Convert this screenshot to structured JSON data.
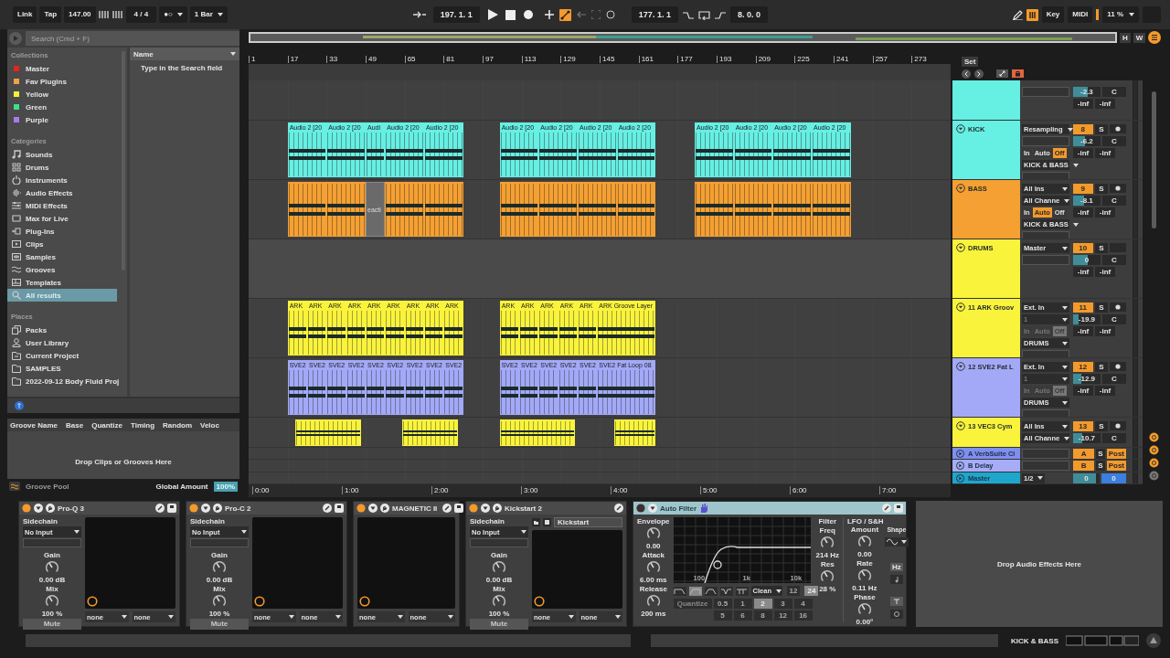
{
  "transport": {
    "link": "Link",
    "tap": "Tap",
    "tempo": "147.00",
    "signature": "4 / 4",
    "metronome": "●○",
    "quantize": "1 Bar",
    "position": "197. 1. 1",
    "automation_arm": true,
    "loop_start": "177. 1. 1",
    "loop_length": "8. 0. 0",
    "computer_keyboard": true,
    "key": "Key",
    "midi": "MIDI",
    "cpu": "11 %"
  },
  "browser": {
    "search": {
      "placeholder": "Search (Cmd + F)"
    },
    "collections_title": "Collections",
    "collections": [
      {
        "label": "Master",
        "color": "#e8221c"
      },
      {
        "label": "Fav Plugins",
        "color": "#f0a048"
      },
      {
        "label": "Yellow",
        "color": "#f4f03a"
      },
      {
        "label": "Green",
        "color": "#3ee08a"
      },
      {
        "label": "Purple",
        "color": "#a57cf0"
      }
    ],
    "categories_title": "Categories",
    "categories": [
      {
        "label": "Sounds",
        "selected": false
      },
      {
        "label": "Drums",
        "selected": false
      },
      {
        "label": "Instruments",
        "selected": false
      },
      {
        "label": "Audio Effects",
        "selected": false
      },
      {
        "label": "MIDI Effects",
        "selected": false
      },
      {
        "label": "Max for Live",
        "selected": false
      },
      {
        "label": "Plug-Ins",
        "selected": false
      },
      {
        "label": "Clips",
        "selected": false
      },
      {
        "label": "Samples",
        "selected": false
      },
      {
        "label": "Grooves",
        "selected": false
      },
      {
        "label": "Templates",
        "selected": false
      },
      {
        "label": "All results",
        "selected": true
      }
    ],
    "places_title": "Places",
    "places": [
      {
        "label": "Packs"
      },
      {
        "label": "User Library"
      },
      {
        "label": "Current Project"
      },
      {
        "label": "SAMPLES"
      },
      {
        "label": "2022-09-12 Body Fluid Proj"
      }
    ],
    "name_column": "Name",
    "hint": "Type in the Search field"
  },
  "groove_pool": {
    "columns": [
      "Groove Name",
      "Base",
      "Quantize",
      "Timing",
      "Random",
      "Veloc"
    ],
    "empty_hint": "Drop Clips or Grooves Here",
    "title": "Groove Pool",
    "global_amount_label": "Global Amount",
    "global_amount": "100%"
  },
  "arrangement": {
    "bar_ticks": [
      "1",
      "17",
      "33",
      "49",
      "65",
      "81",
      "97",
      "113",
      "129",
      "145",
      "161",
      "177",
      "193",
      "209",
      "225",
      "241",
      "257",
      "273"
    ],
    "time_ticks": [
      "0:00",
      "1:00",
      "2:00",
      "3:00",
      "4:00",
      "5:00",
      "6:00",
      "7:00"
    ],
    "zoom_h": "H",
    "zoom_w": "W",
    "set": "Set"
  },
  "tracks": [
    {
      "kind": "partial",
      "color": "#66efe3",
      "volume": {
        "value": "-2.3",
        "level": 0.55
      },
      "pan": "C",
      "peaks": [
        "-inf",
        "-inf"
      ]
    },
    {
      "kind": "audio",
      "name": "KICK",
      "color": "#66efe3",
      "input": "Resampling",
      "monitor": [
        {
          "label": "In",
          "selected": false
        },
        {
          "label": "Auto",
          "selected": false
        },
        {
          "label": "Off",
          "selected": true
        }
      ],
      "monitor_disabled": false,
      "output": "KICK & BASS",
      "number": "8",
      "solo": "S",
      "volume": {
        "value": "-6.2",
        "level": 0.45
      },
      "pan": "C",
      "peaks": [
        "-inf",
        "-inf"
      ],
      "clips": [
        {
          "label": "Audio 2 [20",
          "active": true
        },
        {
          "label": "Audio 2 [20",
          "active": true
        },
        {
          "label": "Audi",
          "active": true
        },
        {
          "label": "Audio 2 [20",
          "active": true
        },
        {
          "label": "Audio 2 [20",
          "active": true
        },
        {
          "label": "Audio 2 [20",
          "active": true
        },
        {
          "label": "Audio 2 [20",
          "active": true
        },
        {
          "label": "Audio 2 [20",
          "active": true
        },
        {
          "label": "Audio 2 [20",
          "active": true
        },
        {
          "label": "Audio 2 [20",
          "active": true
        },
        {
          "label": "Audio 2 [20",
          "active": true
        },
        {
          "label": "Audio 2 [20",
          "active": true
        },
        {
          "label": "Audio 2 [20",
          "active": true
        }
      ]
    },
    {
      "kind": "audio",
      "name": "BASS",
      "color": "#f5a032",
      "input": "All Ins",
      "input_channel": "All Channe",
      "monitor": [
        {
          "label": "In",
          "selected": false
        },
        {
          "label": "Auto",
          "selected": true
        },
        {
          "label": "Off",
          "selected": false
        }
      ],
      "monitor_disabled": false,
      "output": "KICK & BASS",
      "number": "9",
      "solo": "S",
      "volume": {
        "value": "-8.1",
        "level": 0.4
      },
      "pan": "C",
      "peaks": [
        "-inf",
        "-inf"
      ],
      "clips": [
        {
          "active": true
        },
        {
          "active": true
        },
        {
          "label": "eacti",
          "active": false
        },
        {
          "active": true
        },
        {
          "active": true
        },
        {
          "active": true
        },
        {
          "active": true
        },
        {
          "active": true
        },
        {
          "active": true
        },
        {
          "active": true
        },
        {
          "active": true
        },
        {
          "active": true
        },
        {
          "active": true
        }
      ]
    },
    {
      "kind": "group",
      "name": "DRUMS",
      "color": "#f9f33c",
      "output": "Master",
      "number": "10",
      "solo": "S",
      "volume": {
        "value": "0",
        "level": 0.55
      },
      "pan": "C",
      "peaks": [
        "-inf",
        "-inf"
      ]
    },
    {
      "kind": "audio",
      "name": "11 ARK Groov",
      "color": "#f9f33c",
      "input": "Ext. In",
      "input_channel": "1",
      "monitor": [
        {
          "label": "In",
          "selected": false
        },
        {
          "label": "Auto",
          "selected": false
        },
        {
          "label": "Off",
          "selected": true
        }
      ],
      "monitor_disabled": true,
      "output": "DRUMS",
      "number": "11",
      "solo": "S",
      "volume": {
        "value": "-19.9",
        "level": 0.2
      },
      "pan": "C",
      "peaks": [
        "-inf",
        "-inf"
      ],
      "clips": [
        {
          "label": "ARK",
          "active": true
        },
        {
          "label": "ARK",
          "active": true
        },
        {
          "label": "ARK",
          "active": true
        },
        {
          "label": "ARK",
          "active": true
        },
        {
          "label": "ARK",
          "active": true
        },
        {
          "label": "ARK",
          "active": true
        },
        {
          "label": "ARK",
          "active": true
        },
        {
          "label": "ARK",
          "active": true
        },
        {
          "label": "ARK",
          "active": true
        },
        {
          "label": "ARK",
          "active": true
        },
        {
          "label": "ARK",
          "active": true
        },
        {
          "label": "ARK",
          "active": true
        },
        {
          "label": "ARK",
          "active": true
        },
        {
          "label": "ARK",
          "active": true
        },
        {
          "label": "ARK Groove Layer",
          "active": true
        }
      ]
    },
    {
      "kind": "audio",
      "name": "12 SVE2 Fat L",
      "color": "#a3a9f7",
      "input": "Ext. In",
      "input_channel": "1",
      "monitor": [
        {
          "label": "In",
          "selected": false
        },
        {
          "label": "Auto",
          "selected": false
        },
        {
          "label": "Off",
          "selected": true
        }
      ],
      "monitor_disabled": true,
      "output": "DRUMS",
      "number": "12",
      "solo": "S",
      "volume": {
        "value": "-12.9",
        "level": 0.3
      },
      "pan": "C",
      "peaks": [
        "-inf",
        "-inf"
      ],
      "clips": [
        {
          "label": "SVE2",
          "active": true
        },
        {
          "label": "SVE2",
          "active": true
        },
        {
          "label": "SVE2",
          "active": true
        },
        {
          "label": "SVE2",
          "active": true
        },
        {
          "label": "SVE2",
          "active": true
        },
        {
          "label": "SVE2",
          "active": true
        },
        {
          "label": "SVE2",
          "active": true
        },
        {
          "label": "SVE2",
          "active": true
        },
        {
          "label": "SVE2",
          "active": true
        },
        {
          "label": "SVE2",
          "active": true
        },
        {
          "label": "SVE2",
          "active": true
        },
        {
          "label": "SVE2",
          "active": true
        },
        {
          "label": "SVE2",
          "active": true
        },
        {
          "label": "SVE2",
          "active": true
        },
        {
          "label": "SVE2 Fat Loop 08",
          "active": true
        }
      ]
    },
    {
      "kind": "audio",
      "name": "13 VEC3 Cym",
      "color": "#f9f33c",
      "input": "All Ins",
      "input_channel": "All Channe",
      "number": "13",
      "solo": "S",
      "volume": {
        "value": "-10.7",
        "level": 0.35
      },
      "pan": "C",
      "clips": [
        {
          "active": true
        },
        {
          "active": true
        },
        {
          "active": true
        },
        {
          "active": true
        }
      ]
    }
  ],
  "returns": [
    {
      "kind": "return",
      "name": "A VerbSuite Cl",
      "color": "#7f8ff0",
      "number": "A",
      "solo": "S",
      "post": "Post"
    },
    {
      "kind": "return",
      "name": "B Delay",
      "color": "#a6adf6",
      "number": "B",
      "solo": "S",
      "post": "Post"
    },
    {
      "kind": "master",
      "name": "Master",
      "color": "#1ea6cc",
      "output": "1/2",
      "volume": {
        "value": "0",
        "level": 0.85
      },
      "cue": "0"
    }
  ],
  "devices": [
    {
      "kind": "plugin",
      "name": "Pro-Q 3",
      "on": true,
      "sidechain_label": "Sidechain",
      "sidechain": "No Input",
      "gain_label": "Gain",
      "gain": "0.00 dB",
      "mix_label": "Mix",
      "mix": "100 %",
      "mute": "Mute",
      "outputs": [
        "none",
        "none"
      ]
    },
    {
      "kind": "plugin",
      "name": "Pro-C 2",
      "on": true,
      "sidechain_label": "Sidechain",
      "sidechain": "No Input",
      "gain_label": "Gain",
      "gain": "0.00 dB",
      "mix_label": "Mix",
      "mix": "100 %",
      "mute": "Mute",
      "outputs": [
        "none",
        "none"
      ]
    },
    {
      "kind": "plugin",
      "name": "MAGNETIC II",
      "on": true,
      "outputs": [
        "none",
        "none"
      ]
    },
    {
      "kind": "plugin",
      "name": "Kickstart 2",
      "on": true,
      "sidechain_label": "Sidechain",
      "sidechain": "No Input",
      "gain_label": "Gain",
      "gain": "0.00 dB",
      "mix_label": "Mix",
      "mix": "100 %",
      "mute": "Mute",
      "preset": "Kickstart",
      "outputs": [
        "none",
        "none"
      ]
    },
    {
      "kind": "auto_filter",
      "name": "Auto Filter",
      "on": false,
      "envelope_title": "Envelope",
      "envelope": "0.00",
      "attack_label": "Attack",
      "attack": "6.00 ms",
      "release_label": "Release",
      "release": "200 ms",
      "graph_labels": [
        "100",
        "1k",
        "10k"
      ],
      "filter_types": [
        {
          "selected": false
        },
        {
          "selected": true
        },
        {
          "selected": false
        },
        {
          "selected": false
        },
        {
          "selected": false
        }
      ],
      "circuit": "Clean",
      "slopes": [
        {
          "label": "12",
          "selected": false
        },
        {
          "label": "24",
          "selected": true
        }
      ],
      "quantize_label": "Quantize",
      "quantize": [
        {
          "label": "0.5",
          "selected": false
        },
        {
          "label": "1",
          "selected": false
        },
        {
          "label": "2",
          "selected": true
        },
        {
          "label": "3",
          "selected": false
        },
        {
          "label": "4",
          "selected": false
        },
        {
          "label": "5",
          "selected": false
        },
        {
          "label": "6",
          "selected": false
        },
        {
          "label": "8",
          "selected": false
        },
        {
          "label": "12",
          "selected": false
        },
        {
          "label": "16",
          "selected": false
        }
      ],
      "filter_title": "Filter",
      "freq_label": "Freq",
      "freq": "214 Hz",
      "res_label": "Res",
      "res": "28 %",
      "lfo_title": "LFO / S&H",
      "amount_label": "Amount",
      "amount": "0.00",
      "shape_label": "Shape",
      "rate_label": "Rate",
      "rate": "0.11 Hz",
      "rate_unit": "Hz",
      "phase_label": "Phase",
      "phase": "0.00°"
    }
  ],
  "drop_hint": "Drop Audio Effects Here",
  "status_bar": {
    "track": "KICK & BASS"
  }
}
